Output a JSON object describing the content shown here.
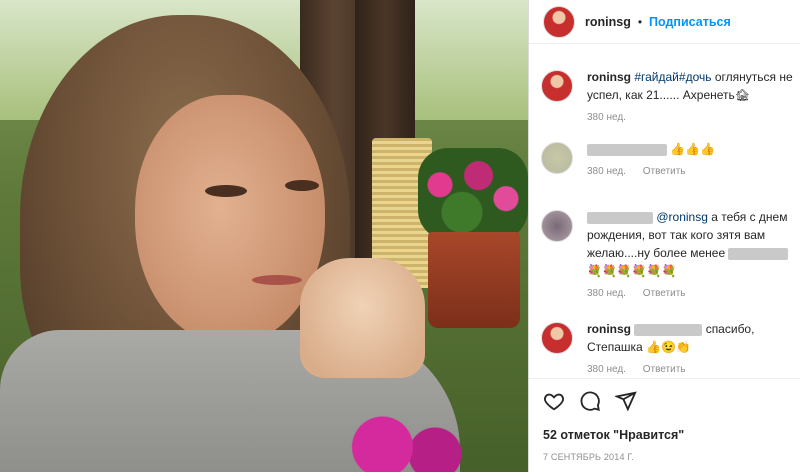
{
  "post": {
    "author": "roninsg",
    "follow_label": "Подписаться",
    "dot": "•"
  },
  "comments": [
    {
      "user": "roninsg",
      "text_parts": {
        "tag1": "#гайдай",
        "tag2": "#дочь",
        "body": " оглянуться не успел, как 21...... Ахренеть🏚"
      },
      "time": "380 нед."
    },
    {
      "user": "",
      "text": "👍👍👍",
      "time": "380 нед.",
      "reply_label": "Ответить"
    },
    {
      "user": "",
      "mention": "@roninsg",
      "text": " а тебя с днем рождения, вот так кого зятя вам желаю....ну более менее",
      "emoji": "💐💐💐💐💐💐",
      "time": "380 нед.",
      "reply_label": "Ответить"
    },
    {
      "user": "roninsg",
      "text": "спасибо, Степашка 👍😉👏",
      "time": "380 нед.",
      "reply_label": "Ответить"
    }
  ],
  "actions": {
    "like_icon": "heart-icon",
    "comment_icon": "comment-icon",
    "share_icon": "share-icon"
  },
  "likes_text": "52 отметок \"Нравится\"",
  "date_text": "7 СЕНТЯБРЬ 2014 Г."
}
